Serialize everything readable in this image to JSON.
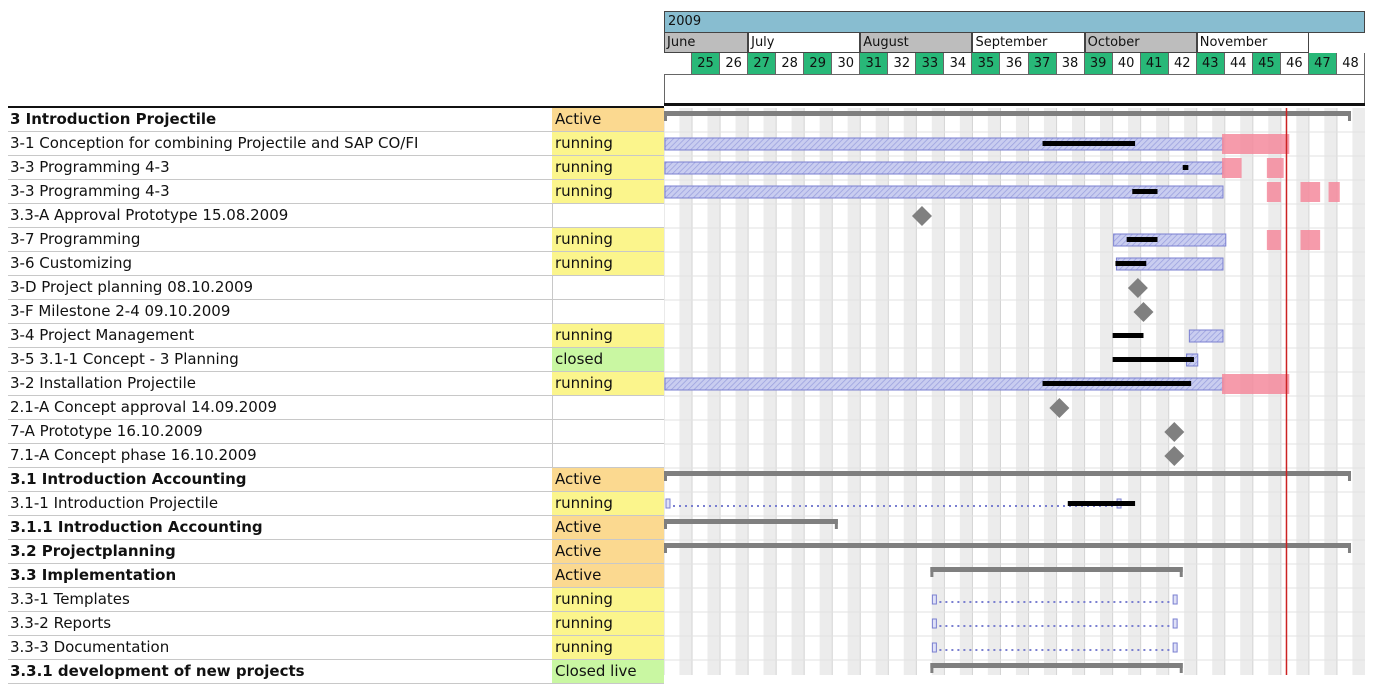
{
  "timeline": {
    "year": "2009",
    "months": [
      {
        "label": "June",
        "weeks": 2,
        "shade": "grey"
      },
      {
        "label": "July",
        "weeks": 4,
        "shade": "white"
      },
      {
        "label": "August",
        "weeks": 4,
        "shade": "grey"
      },
      {
        "label": "September",
        "weeks": 4,
        "shade": "white"
      },
      {
        "label": "October",
        "weeks": 4,
        "shade": "grey"
      },
      {
        "label": "November",
        "weeks": 4,
        "shade": "white"
      }
    ],
    "weeks": [
      "",
      "25",
      "26",
      "27",
      "28",
      "29",
      "30",
      "31",
      "32",
      "33",
      "34",
      "35",
      "36",
      "37",
      "38",
      "39",
      "40",
      "41",
      "42",
      "43",
      "44",
      "45",
      "46",
      "47",
      "48"
    ],
    "green_weeks": [
      "25",
      "27",
      "29",
      "31",
      "33",
      "35",
      "37",
      "39",
      "41",
      "43",
      "45",
      "47"
    ],
    "today_week": 46.2
  },
  "colors": {
    "active": "#fbd990",
    "running": "#fbf58c",
    "closed": "#c9f7a2",
    "week_green": "#28b878",
    "year_bar": "#88bdd0",
    "plan_bar": "#c9cdf0",
    "plan_bar_border": "#7a7fd0",
    "actual_bar": "#000000",
    "milestone": "#808080",
    "summary_bar": "#7f7f7f",
    "today_line": "#cc2222",
    "overload": "#f58a9c"
  },
  "tasks": [
    {
      "name": "3 Introduction Projectile",
      "status": "Active",
      "state": "active",
      "summary": true,
      "bars": [
        {
          "kind": "summary",
          "start": 24.0,
          "end": 48.5
        }
      ]
    },
    {
      "name": "3-1 Conception for combining Projectile and SAP CO/FI",
      "status": "running",
      "state": "running",
      "summary": false,
      "bars": [
        {
          "kind": "plan",
          "start": 24.0,
          "end": 43.9
        },
        {
          "kind": "actual",
          "start": 37.5,
          "end": 40.8
        },
        {
          "kind": "overload",
          "start": 43.9,
          "end": 46.3
        }
      ]
    },
    {
      "name": "3-3 Programming 4-3",
      "status": "running",
      "state": "running",
      "summary": false,
      "bars": [
        {
          "kind": "plan",
          "start": 24.0,
          "end": 43.9
        },
        {
          "kind": "actual",
          "start": 42.5,
          "end": 42.7
        },
        {
          "kind": "overload",
          "start": 43.9,
          "end": 44.6
        },
        {
          "kind": "overload",
          "start": 45.5,
          "end": 46.1
        }
      ]
    },
    {
      "name": "3-3 Programming 4-3",
      "status": "running",
      "state": "running",
      "summary": false,
      "bars": [
        {
          "kind": "plan",
          "start": 24.0,
          "end": 43.9
        },
        {
          "kind": "actual",
          "start": 40.7,
          "end": 41.6
        },
        {
          "kind": "overload",
          "start": 45.5,
          "end": 46.0
        },
        {
          "kind": "overload",
          "start": 46.7,
          "end": 47.4
        },
        {
          "kind": "overload",
          "start": 47.7,
          "end": 48.1
        }
      ]
    },
    {
      "name": "3.3-A Approval Prototype 15.08.2009",
      "status": "",
      "state": "none",
      "summary": false,
      "bars": [
        {
          "kind": "milestone",
          "at": 33.2
        }
      ]
    },
    {
      "name": "3-7 Programming",
      "status": "running",
      "state": "running",
      "summary": false,
      "bars": [
        {
          "kind": "plan",
          "start": 40.0,
          "end": 44.0
        },
        {
          "kind": "actual",
          "start": 40.5,
          "end": 41.6
        },
        {
          "kind": "overload",
          "start": 45.5,
          "end": 46.0
        },
        {
          "kind": "overload",
          "start": 46.7,
          "end": 47.4
        }
      ]
    },
    {
      "name": "3-6 Customizing",
      "status": "running",
      "state": "running",
      "summary": false,
      "bars": [
        {
          "kind": "plan",
          "start": 40.1,
          "end": 43.9
        },
        {
          "kind": "actual",
          "start": 40.1,
          "end": 41.2
        }
      ]
    },
    {
      "name": "3-D Project planning 08.10.2009",
      "status": "",
      "state": "none",
      "summary": false,
      "bars": [
        {
          "kind": "milestone",
          "at": 40.9
        }
      ]
    },
    {
      "name": "3-F Milestone 2-4 09.10.2009",
      "status": "",
      "state": "none",
      "summary": false,
      "bars": [
        {
          "kind": "milestone",
          "at": 41.1
        }
      ]
    },
    {
      "name": "3-4 Project Management",
      "status": "running",
      "state": "running",
      "summary": false,
      "bars": [
        {
          "kind": "plan",
          "start": 42.7,
          "end": 43.9
        },
        {
          "kind": "actual",
          "start": 40.0,
          "end": 41.1
        }
      ]
    },
    {
      "name": "3-5 3.1-1 Concept - 3 Planning",
      "status": "closed",
      "state": "closed",
      "summary": false,
      "bars": [
        {
          "kind": "plan",
          "start": 42.6,
          "end": 43.0
        },
        {
          "kind": "actual",
          "start": 40.0,
          "end": 42.9
        }
      ]
    },
    {
      "name": "3-2 Installation  Projectile",
      "status": "running",
      "state": "running",
      "summary": false,
      "bars": [
        {
          "kind": "plan",
          "start": 24.0,
          "end": 43.9
        },
        {
          "kind": "actual",
          "start": 37.5,
          "end": 42.8
        },
        {
          "kind": "overload",
          "start": 43.9,
          "end": 46.3
        }
      ]
    },
    {
      "name": "2.1-A Concept approval 14.09.2009",
      "status": "",
      "state": "none",
      "summary": false,
      "bars": [
        {
          "kind": "milestone",
          "at": 38.1
        }
      ]
    },
    {
      "name": "7-A Prototype 16.10.2009",
      "status": "",
      "state": "none",
      "summary": false,
      "bars": [
        {
          "kind": "milestone",
          "at": 42.2
        }
      ]
    },
    {
      "name": "7.1-A Concept phase 16.10.2009",
      "status": "",
      "state": "none",
      "summary": false,
      "bars": [
        {
          "kind": "milestone",
          "at": 42.2
        }
      ]
    },
    {
      "name": "3.1 Introduction Accounting",
      "status": "Active",
      "state": "active",
      "summary": true,
      "bars": [
        {
          "kind": "summary",
          "start": 24.0,
          "end": 48.5
        }
      ]
    },
    {
      "name": "3.1-1 Introduction Projectile",
      "status": "running",
      "state": "running",
      "summary": false,
      "bars": [
        {
          "kind": "dotted",
          "start": 24.0,
          "end": 40.3
        },
        {
          "kind": "actual",
          "start": 38.4,
          "end": 40.8
        }
      ]
    },
    {
      "name": "3.1.1 Introduction Accounting",
      "status": "Active",
      "state": "active",
      "summary": true,
      "bars": [
        {
          "kind": "summary",
          "start": 24.0,
          "end": 30.2
        }
      ]
    },
    {
      "name": "3.2 Projectplanning",
      "status": "Active",
      "state": "active",
      "summary": true,
      "bars": [
        {
          "kind": "summary",
          "start": 24.0,
          "end": 48.5
        }
      ]
    },
    {
      "name": "3.3 Implementation",
      "status": "Active",
      "state": "active",
      "summary": true,
      "bars": [
        {
          "kind": "summary",
          "start": 33.5,
          "end": 42.5
        }
      ]
    },
    {
      "name": "3.3-1 Templates",
      "status": "running",
      "state": "running",
      "summary": false,
      "bars": [
        {
          "kind": "dotted",
          "start": 33.5,
          "end": 42.3
        }
      ]
    },
    {
      "name": "3.3-2 Reports",
      "status": "running",
      "state": "running",
      "summary": false,
      "bars": [
        {
          "kind": "dotted",
          "start": 33.5,
          "end": 42.3
        }
      ]
    },
    {
      "name": "3.3-3 Documentation",
      "status": "running",
      "state": "running",
      "summary": false,
      "bars": [
        {
          "kind": "dotted",
          "start": 33.5,
          "end": 42.3
        }
      ]
    },
    {
      "name": "3.3.1 development of new projects",
      "status": "Closed live",
      "state": "closed",
      "summary": true,
      "bars": [
        {
          "kind": "summary",
          "start": 33.5,
          "end": 42.5
        }
      ]
    }
  ]
}
